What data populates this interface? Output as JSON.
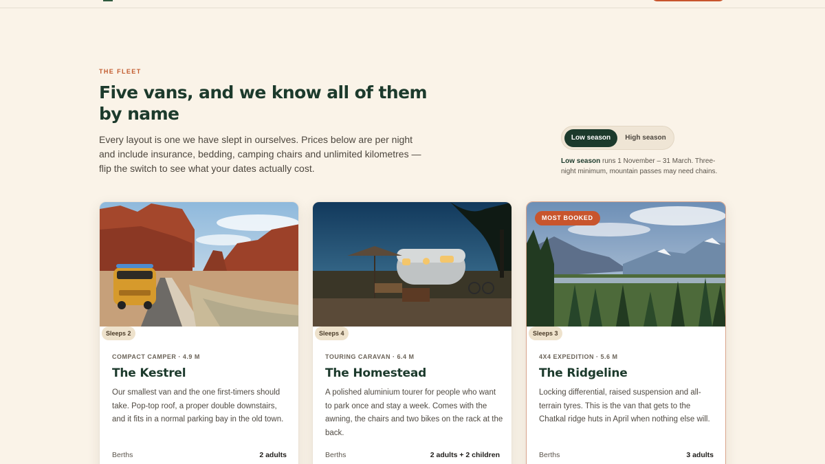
{
  "section": {
    "eyebrow": "THE FLEET",
    "title": "Five vans, and we know all of them by name",
    "intro": "Every layout is one we have slept in ourselves. Prices below are per night and include insurance, bedding, camping chairs and unlimited kilometres — flip the switch to see what your dates actually cost."
  },
  "season_toggle": {
    "options": [
      "Low season",
      "High season"
    ],
    "selected": "Low season",
    "note_strong": "Low season",
    "note_text": " runs 1 November – 31 March. Three-night minimum, mountain passes may need chains."
  },
  "cards": [
    {
      "sleeps": "Sleeps 2",
      "kicker": "COMPACT CAMPER · 4.9 M",
      "name": "The Kestrel",
      "description": "Our smallest van and the one first-timers should take. Pop-top roof, a proper double downstairs, and it fits in a normal parking bay in the old town.",
      "spec_label": "Berths",
      "spec_value": "2 adults",
      "image": "desert-road-van"
    },
    {
      "sleeps": "Sleeps 4",
      "kicker": "TOURING CARAVAN · 6.4 M",
      "name": "The Homestead",
      "description": "A polished aluminium tourer for people who want to park once and stay a week. Comes with the awning, the chairs and two bikes on the rack at the back.",
      "spec_label": "Berths",
      "spec_value": "2 adults + 2 children",
      "image": "airstream-campsite"
    },
    {
      "badge": "MOST BOOKED",
      "sleeps": "Sleeps 3",
      "kicker": "4X4 EXPEDITION · 5.6 M",
      "name": "The Ridgeline",
      "description": "Locking differential, raised suspension and all-terrain tyres. This is the van that gets to the Chatkal ridge huts in April when nothing else will.",
      "spec_label": "Berths",
      "spec_value": "3 adults",
      "image": "mountain-valley"
    }
  ],
  "colors": {
    "background": "#faf3e8",
    "accent": "#c8552d",
    "forest": "#1c3a2c",
    "badge_bg": "#eee2cc"
  }
}
